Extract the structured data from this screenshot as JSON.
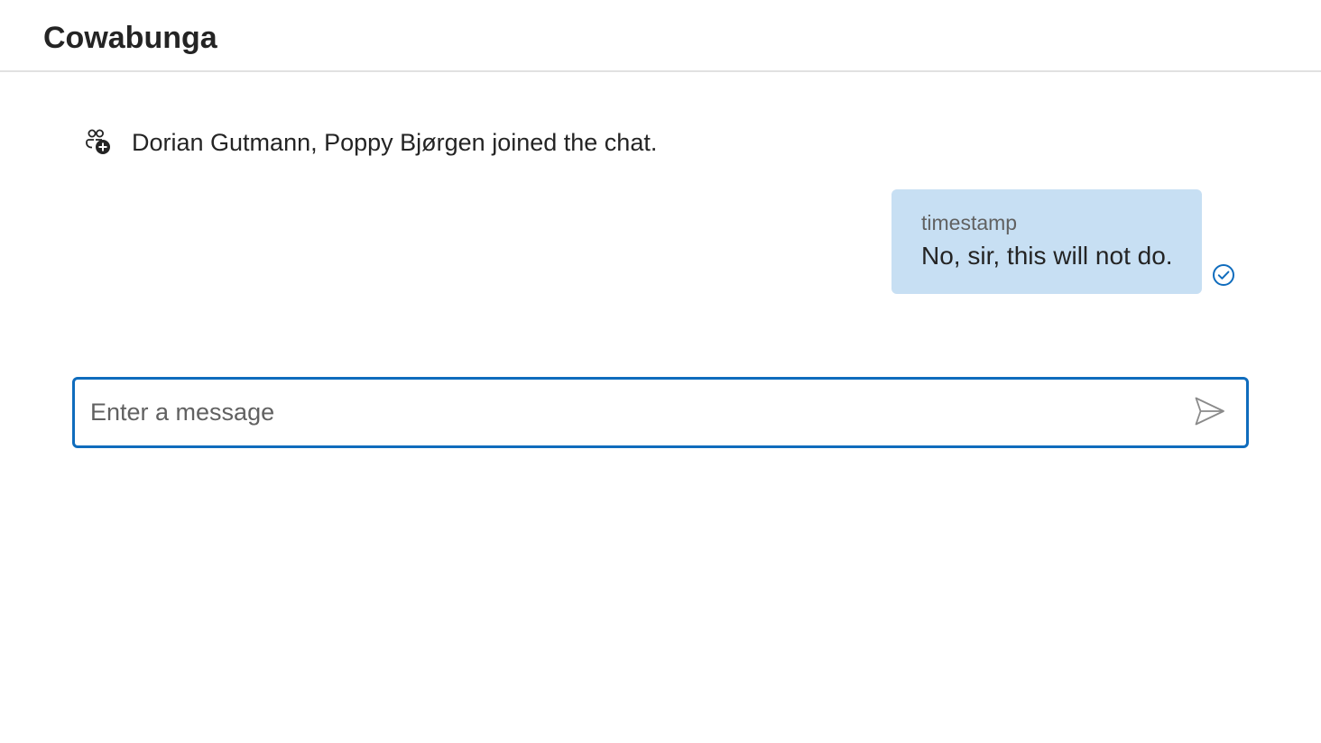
{
  "header": {
    "title": "Cowabunga"
  },
  "messages": {
    "system": {
      "icon": "person-add-icon",
      "text": "Dorian Gutmann, Poppy Bjørgen joined the chat."
    },
    "sent": {
      "timestamp": "timestamp",
      "text": "No, sir, this will not do.",
      "status_icon": "checkmark-circle-icon",
      "bubble_color": "#c7dff3"
    }
  },
  "composer": {
    "placeholder": "Enter a message",
    "value": "",
    "send_icon": "send-icon",
    "border_color": "#0f6cbd"
  }
}
